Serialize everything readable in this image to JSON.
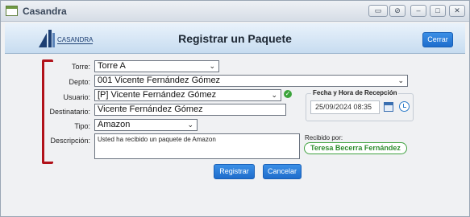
{
  "window": {
    "title": "Casandra"
  },
  "header": {
    "title": "Registrar un Paquete",
    "close_label": "Cerrar",
    "logo_text": "CASANDRA"
  },
  "form": {
    "torre": {
      "label": "Torre:",
      "value": "Torre A"
    },
    "depto": {
      "label": "Depto:",
      "value": "001 Vicente Fernández Gómez"
    },
    "usuario": {
      "label": "Usuario:",
      "value": "[P] Vicente Fernández Gómez"
    },
    "destinatario": {
      "label": "Destinatario:",
      "value": "Vicente Fernández Gómez"
    },
    "tipo": {
      "label": "Tipo:",
      "value": "Amazon"
    },
    "descripcion": {
      "label": "Descripción:",
      "value": "Usted ha recibido un paquete de Amazon"
    }
  },
  "reception": {
    "legend": "Fecha y Hora de Recepción",
    "datetime": "25/09/2024 08:35"
  },
  "received_by": {
    "label": "Recibido por:",
    "name": "Teresa Becerra Fernández"
  },
  "actions": {
    "register_label": "Registrar",
    "cancel_label": "Cancelar"
  },
  "colors": {
    "accent_blue": "#1f6dcc",
    "bracket_red": "#b1121a",
    "success_green": "#3fa13f"
  }
}
